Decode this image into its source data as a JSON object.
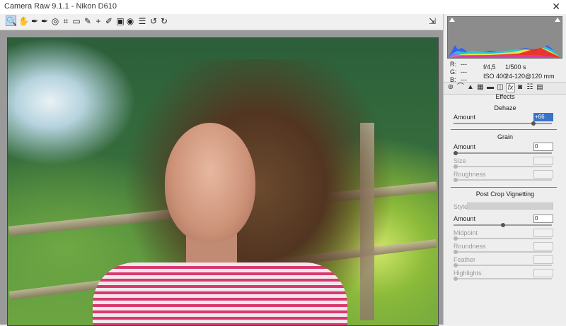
{
  "window": {
    "title": "Camera Raw 9.1.1  -  Nikon D610",
    "close_glyph": "✕"
  },
  "toolbar": {
    "tools": [
      {
        "name": "zoom-tool-icon",
        "glyph": "🔍",
        "active": true
      },
      {
        "name": "hand-tool-icon",
        "glyph": "✋"
      },
      {
        "name": "white-balance-tool-icon",
        "glyph": "✒"
      },
      {
        "name": "color-sampler-tool-icon",
        "glyph": "✒"
      },
      {
        "name": "targeted-adjustment-tool-icon",
        "glyph": "◎"
      },
      {
        "name": "crop-tool-icon",
        "glyph": "⌗"
      },
      {
        "name": "straighten-tool-icon",
        "glyph": "▭"
      },
      {
        "name": "spot-removal-tool-icon",
        "glyph": "✎"
      },
      {
        "name": "red-eye-removal-tool-icon",
        "glyph": "+"
      },
      {
        "name": "adjustment-brush-icon",
        "glyph": "✐"
      },
      {
        "name": "graduated-filter-icon",
        "glyph": "▣"
      },
      {
        "name": "radial-filter-icon",
        "glyph": "◉"
      },
      {
        "name": "preferences-icon",
        "glyph": "☰"
      },
      {
        "name": "rotate-left-icon",
        "glyph": "↺"
      },
      {
        "name": "rotate-right-icon",
        "glyph": "↻"
      }
    ],
    "fullscreen_glyph": "⇲"
  },
  "readout": {
    "r_label": "R:",
    "r_value": "---",
    "g_label": "G:",
    "g_value": "---",
    "b_label": "B:",
    "b_value": "---",
    "aperture": "f/4,5",
    "shutter": "1/500 s",
    "iso": "ISO 400",
    "lens": "24-120@120 mm"
  },
  "panel_tabs": [
    {
      "name": "basic-tab-icon",
      "glyph": "⊛"
    },
    {
      "name": "tone-curve-tab-icon",
      "glyph": "⌒"
    },
    {
      "name": "detail-tab-icon",
      "glyph": "▲"
    },
    {
      "name": "hsl-tab-icon",
      "glyph": "▦"
    },
    {
      "name": "split-toning-tab-icon",
      "glyph": "▬"
    },
    {
      "name": "lens-corrections-tab-icon",
      "glyph": "◫"
    },
    {
      "name": "effects-tab-icon",
      "glyph": "fx",
      "active": true
    },
    {
      "name": "camera-calibration-tab-icon",
      "glyph": "◙"
    },
    {
      "name": "presets-tab-icon",
      "glyph": "☷"
    },
    {
      "name": "snapshots-tab-icon",
      "glyph": "▤"
    }
  ],
  "effects": {
    "panel_title": "Effects",
    "dehaze": {
      "title": "Dehaze",
      "amount_label": "Amount",
      "amount_value": "+66",
      "amount_level": 0.83
    },
    "grain": {
      "title": "Grain",
      "amount_label": "Amount",
      "amount_value": "0",
      "amount_level": 0,
      "size_label": "Size",
      "roughness_label": "Roughness"
    },
    "vignetting": {
      "title": "Post Crop Vignetting",
      "style_label": "Style:",
      "amount_label": "Amount",
      "amount_value": "0",
      "amount_level": 0.5,
      "midpoint_label": "Midpoint",
      "roundness_label": "Roundness",
      "feather_label": "Feather",
      "highlights_label": "Highlights"
    }
  },
  "colors": {
    "selection": "#3b73c9",
    "histogram_bg": "#8c8c8c"
  }
}
